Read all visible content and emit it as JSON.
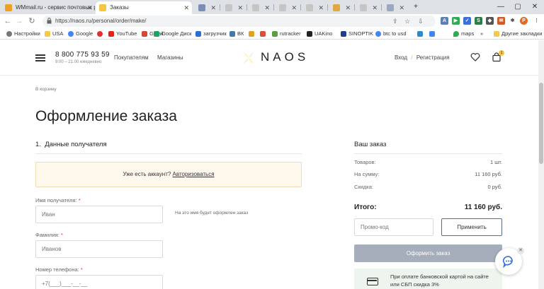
{
  "browser": {
    "tabs": [
      {
        "title": "WMmail.ru - сервис почтовых ра",
        "active": false
      },
      {
        "title": "Заказы",
        "active": true
      },
      {
        "title": "",
        "active": false
      },
      {
        "title": "",
        "active": false
      },
      {
        "title": "",
        "active": false
      },
      {
        "title": "",
        "active": false
      },
      {
        "title": "",
        "active": false
      },
      {
        "title": "",
        "active": false
      }
    ],
    "new_tab": "+",
    "url": "https://naos.ru/personal/order/make/",
    "bookmarks": [
      "Настройки",
      "USA",
      "Google",
      "",
      "YouTube",
      "Gmail",
      "Google Диск",
      "загрузчик",
      "ВК",
      "",
      "",
      "rutracker",
      "UAKino",
      "SINOPTIK",
      "btc to usd",
      "",
      "",
      "maps"
    ],
    "bookmarks_more": "»",
    "other_bookmarks": "Другие закладки"
  },
  "header": {
    "phone": "8 800 775 93 59",
    "hours": "9:00 – 21:00 ежедневно",
    "nav": [
      "Покупателям",
      "Магазины"
    ],
    "logo": "NAOS",
    "login": "Вход",
    "login_sep": "/",
    "register": "Регистрация",
    "cart_count": "1"
  },
  "page": {
    "back_link": "В корзину",
    "title": "Оформление заказа",
    "section1": "1.  Данные получателя",
    "notice_text": "Уже есть аккаунт?",
    "notice_link": "Авторизоваться",
    "fields": [
      {
        "label": "Имя получателя:",
        "required": "*",
        "placeholder": "Иван"
      },
      {
        "label": "Фамилия:",
        "required": "*",
        "placeholder": "Иванов"
      },
      {
        "label": "Номер телефона:",
        "required": "*",
        "placeholder": "+7(___)___-__-__"
      }
    ],
    "name_hint": "На это имя будет оформлен заказ"
  },
  "order": {
    "title": "Ваш заказ",
    "rows": [
      {
        "label": "Товаров:",
        "value": "1 шт."
      },
      {
        "label": "На сумму:",
        "value": "11 160 руб."
      },
      {
        "label": "Скидка:",
        "value": "0 руб."
      }
    ],
    "total_label": "Итого:",
    "total_value": "11 160 руб.",
    "promo_placeholder": "Промо-код",
    "apply": "Применить",
    "checkout": "Оформить заказ",
    "sbp_text": "При оплате банковской картой на сайте или СБП скидка 3%"
  },
  "colors": {
    "accent": "#f5c542",
    "checkout_bg": "#a6aebc",
    "notice_bg": "#fff8ec",
    "sbp_bg": "#edf5ee"
  }
}
